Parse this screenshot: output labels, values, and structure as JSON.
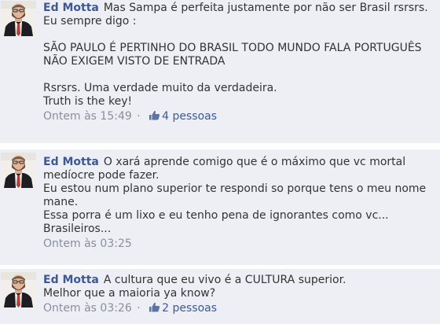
{
  "comments": [
    {
      "author": "Ed Motta",
      "lines": [
        "Mas Sampa é perfeita justamente por não ser Brasil rsrsrs.",
        "Eu sempre digo :",
        "",
        "SÃO PAULO É PERTINHO DO BRASIL TODO MUNDO FALA PORTUGUÊS",
        "NÃO EXIGEM VISTO DE ENTRADA",
        "",
        "Rsrsrs. Uma verdade muito da verdadeira.",
        "Truth is the key!"
      ],
      "timestamp": "Ontem às 15:49",
      "separator": "·",
      "likes": "4 pessoas"
    },
    {
      "author": "Ed Motta",
      "lines": [
        "O xará aprende comigo que é o máximo que vc mortal",
        "medíocre pode fazer.",
        "Eu estou num plano superior te respondi so porque tens o meu nome",
        "mane.",
        "Essa porra é um lixo e eu tenho pena de ignorantes como vc...",
        "Brasileiros..."
      ],
      "timestamp": "Ontem às 03:25"
    },
    {
      "author": "Ed Motta",
      "lines": [
        "A cultura que eu vivo é a CULTURA superior.",
        "Melhor que a maioria ya know?"
      ],
      "timestamp": "Ontem às 03:26",
      "separator": "·",
      "likes": "2 pessoas"
    }
  ],
  "icons": {
    "like": "thumbs-up-icon",
    "avatar": "profile-photo-avatar"
  },
  "colors": {
    "background": "#edeff4",
    "author": "#3b5998",
    "meta": "#898f9c",
    "text": "#333333"
  }
}
